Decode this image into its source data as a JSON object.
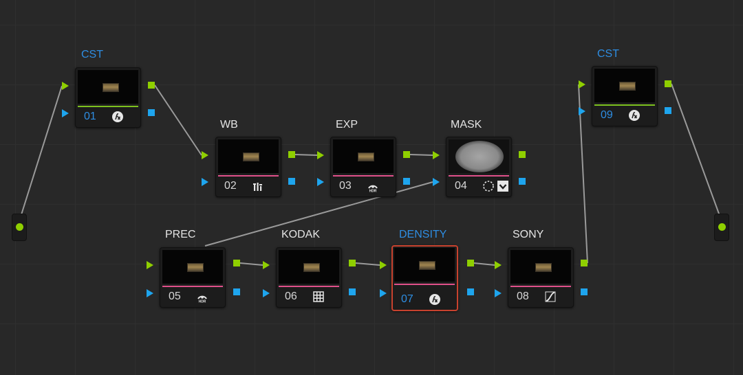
{
  "nodes": [
    {
      "id": "01",
      "label": "CST",
      "label_color": "blue",
      "num": "01",
      "num_color": "blue",
      "icon": "fx-icon",
      "bar": "green-bar"
    },
    {
      "id": "02",
      "label": "WB",
      "label_color": "white",
      "num": "02",
      "num_color": "white",
      "icon": "levels-icon",
      "bar": "pink-bar"
    },
    {
      "id": "03",
      "label": "EXP",
      "label_color": "white",
      "num": "03",
      "num_color": "white",
      "icon": "hdr-icon",
      "bar": "pink-bar"
    },
    {
      "id": "04",
      "label": "MASK",
      "label_color": "white",
      "num": "04",
      "num_color": "white",
      "icon": "window-mask-icon",
      "bar": "pink-bar"
    },
    {
      "id": "05",
      "label": "PREC",
      "label_color": "white",
      "num": "05",
      "num_color": "white",
      "icon": "hdr-icon",
      "bar": "pink-bar"
    },
    {
      "id": "06",
      "label": "KODAK",
      "label_color": "white",
      "num": "06",
      "num_color": "white",
      "icon": "lut-grid-icon",
      "bar": "pink-bar"
    },
    {
      "id": "07",
      "label": "DENSITY",
      "label_color": "blue",
      "num": "07",
      "num_color": "blue",
      "icon": "fx-icon",
      "bar": "pink-bar",
      "selected": true
    },
    {
      "id": "08",
      "label": "SONY",
      "label_color": "white",
      "num": "08",
      "num_color": "white",
      "icon": "curves-icon",
      "bar": "pink-bar"
    },
    {
      "id": "09",
      "label": "CST",
      "label_color": "blue",
      "num": "09",
      "num_color": "blue",
      "icon": "fx-icon",
      "bar": "green-bar"
    }
  ],
  "connections": [
    [
      "source",
      "01"
    ],
    [
      "01",
      "02"
    ],
    [
      "02",
      "03"
    ],
    [
      "03",
      "04"
    ],
    [
      "05",
      "04"
    ],
    [
      "05",
      "06"
    ],
    [
      "06",
      "07"
    ],
    [
      "07",
      "08"
    ],
    [
      "08",
      "09"
    ],
    [
      "09",
      "output"
    ]
  ],
  "colors": {
    "background": "#282828",
    "node_bg": "#1c1c1c",
    "rgb_port": "#8fcf00",
    "alpha_port": "#1ea5ee",
    "label_blue": "#2e8de2",
    "pink_bar": "#e0508a",
    "green_bar": "#7dc21e",
    "selection": "#c9422e"
  }
}
